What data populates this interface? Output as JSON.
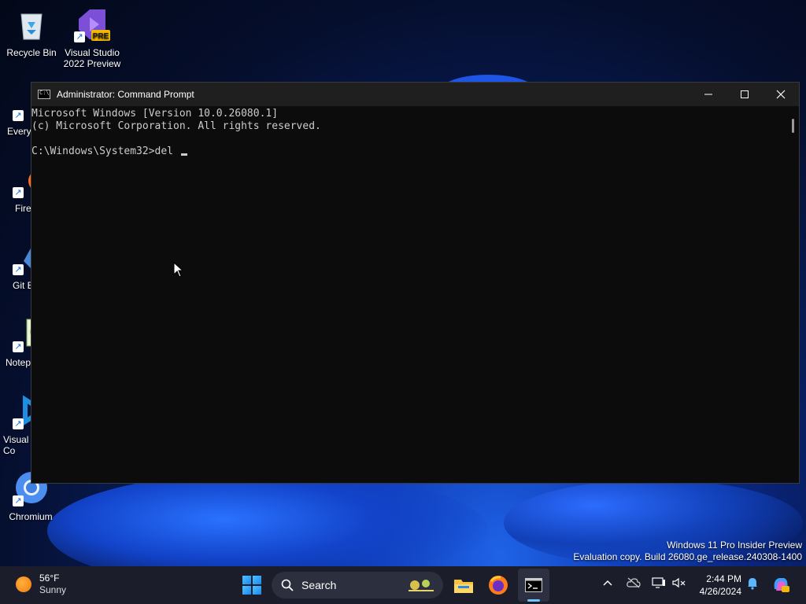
{
  "desktop": {
    "icons": [
      {
        "label": "Recycle Bin",
        "icon": "recycle-bin-icon"
      },
      {
        "label": "Visual Studio\n2022 Preview",
        "icon": "visual-studio-icon",
        "badge": "PRE"
      },
      {
        "label": "Every",
        "icon": "everything-icon"
      },
      {
        "label": "Fire",
        "icon": "firefox-icon"
      },
      {
        "label": "Git E",
        "icon": "git-extensions-icon"
      },
      {
        "label": "Notep",
        "icon": "notepad-plus-icon"
      },
      {
        "label": "Visual\nCo",
        "icon": "vscode-icon"
      },
      {
        "label": "Chromium",
        "icon": "chromium-icon"
      }
    ]
  },
  "window": {
    "title": "Administrator: Command Prompt",
    "controls": {
      "minimize": "—",
      "maximize": "☐",
      "close": "✕"
    },
    "console_lines": [
      "Microsoft Windows [Version 10.0.26080.1]",
      "(c) Microsoft Corporation. All rights reserved.",
      "",
      "C:\\Windows\\System32>del "
    ]
  },
  "watermark": {
    "line1": "Windows 11 Pro Insider Preview",
    "line2": "Evaluation copy. Build 26080.ge_release.240308-1400"
  },
  "taskbar": {
    "weather": {
      "temp": "56°F",
      "condition": "Sunny"
    },
    "search_placeholder": "Search",
    "pinned": [
      "file-explorer-icon",
      "firefox-icon",
      "terminal-icon"
    ],
    "clock": {
      "time": "2:44 PM",
      "date": "4/26/2024"
    }
  },
  "colors": {
    "console_bg": "#0c0c0c",
    "console_fg": "#cccccc",
    "titlebar_bg": "#1f1f1f",
    "taskbar_bg": "#1b1d2a",
    "accent": "#6cc6ff"
  }
}
